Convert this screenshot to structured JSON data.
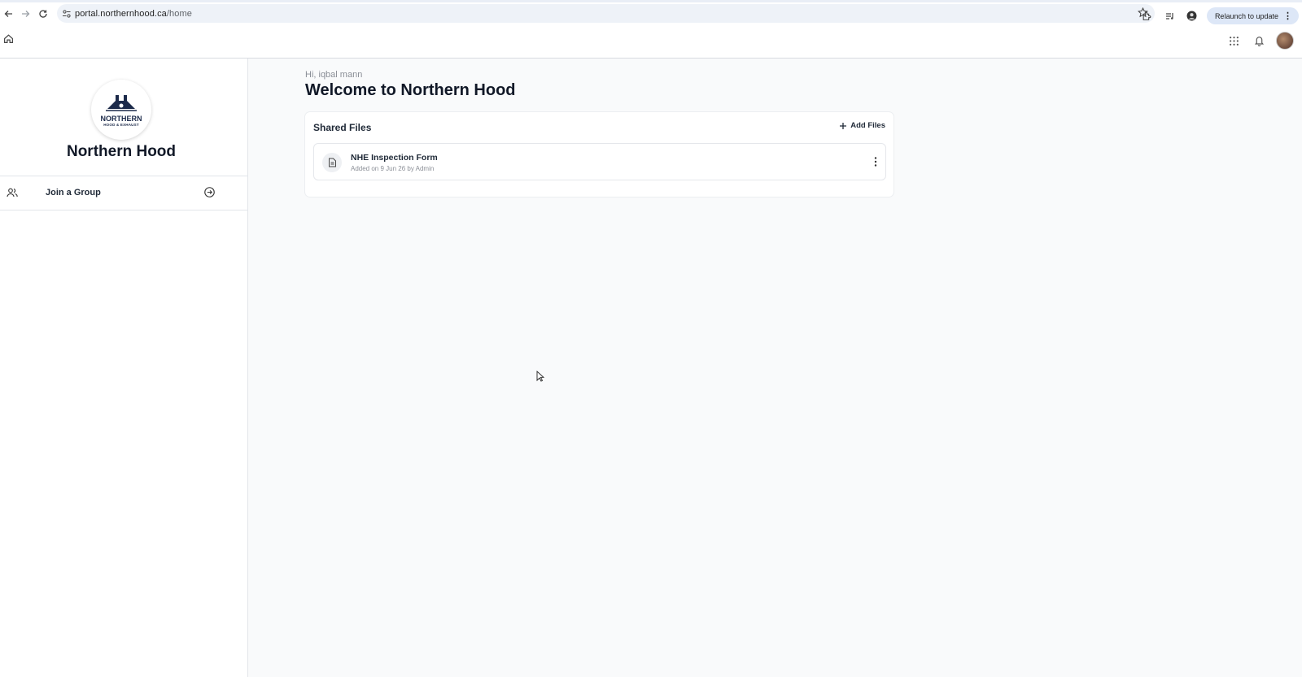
{
  "browser": {
    "url_domain": "portal.northernhood.ca",
    "url_path": "/home",
    "relaunch_label": "Relaunch to update",
    "icons": [
      "back-icon",
      "forward-icon",
      "reload-icon",
      "site-info-icon",
      "bookmark-star-icon",
      "extensions-icon",
      "media-icon",
      "profile-icon",
      "more-menu-icon"
    ]
  },
  "header": {
    "icons": [
      "home-icon",
      "apps-grid-icon",
      "bell-icon",
      "avatar"
    ]
  },
  "sidebar": {
    "logo_word": "NORTHERN",
    "logo_sub": "HOOD & EXHAUST",
    "org_name": "Northern Hood",
    "join_label": "Join a Group"
  },
  "main": {
    "greeting": "Hi, iqbal mann",
    "title": "Welcome to Northern Hood",
    "shared_files": {
      "title": "Shared Files",
      "add_label": "Add Files",
      "files": [
        {
          "name": "NHE Inspection Form",
          "meta": "Added on 9 Jun 26 by Admin"
        }
      ]
    }
  },
  "colors": {
    "brand_navy": "#1c2a4a",
    "main_bg": "#f9fafb",
    "relaunch_bg": "#dde7f7"
  }
}
